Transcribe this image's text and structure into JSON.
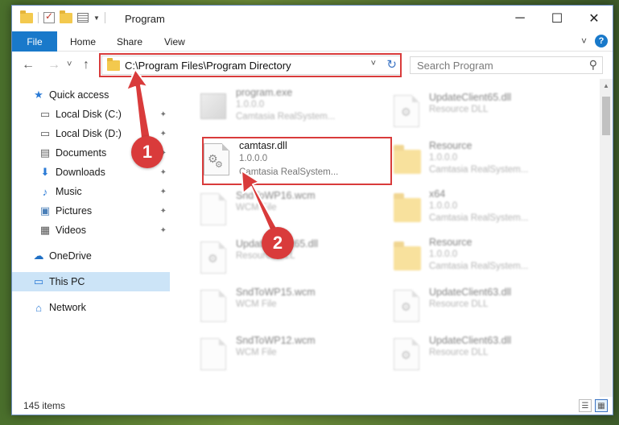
{
  "window": {
    "title": "Program",
    "controls": {
      "minimize": "─",
      "maximize": "☐",
      "close": "✕"
    }
  },
  "ribbon": {
    "file": "File",
    "tabs": [
      "Home",
      "Share",
      "View"
    ],
    "collapse": "˅",
    "help": "?"
  },
  "nav": {
    "back": "←",
    "forward": "→",
    "recent": "˅",
    "up": "↑",
    "address": "C:\\Program Files\\Program Directory",
    "address_chevron": "˅",
    "refresh": "↻",
    "search_placeholder": "Search Program",
    "search_icon": "⚲"
  },
  "sidebar": {
    "items": [
      {
        "label": "Quick access",
        "icon": "star-icon",
        "glyph": "★",
        "pinned": false
      },
      {
        "label": "Local Disk (C:)",
        "icon": "drive-icon",
        "glyph": "▭",
        "pinned": true
      },
      {
        "label": "Local Disk (D:)",
        "icon": "drive-icon",
        "glyph": "▭",
        "pinned": true
      },
      {
        "label": "Documents",
        "icon": "documents-icon",
        "glyph": "▤",
        "pinned": true
      },
      {
        "label": "Downloads",
        "icon": "downloads-icon",
        "glyph": "⬇",
        "pinned": true
      },
      {
        "label": "Music",
        "icon": "music-icon",
        "glyph": "♪",
        "pinned": true
      },
      {
        "label": "Pictures",
        "icon": "pictures-icon",
        "glyph": "▣",
        "pinned": true
      },
      {
        "label": "Videos",
        "icon": "videos-icon",
        "glyph": "▦",
        "pinned": true
      },
      {
        "label": "OneDrive",
        "icon": "cloud-icon",
        "glyph": "☁",
        "pinned": false
      },
      {
        "label": "This PC",
        "icon": "computer-icon",
        "glyph": "▭",
        "pinned": false,
        "selected": true
      },
      {
        "label": "Network",
        "icon": "network-icon",
        "glyph": "⌂",
        "pinned": false
      }
    ],
    "pin_glyph": "📌"
  },
  "files": {
    "left": [
      {
        "name": "program.exe",
        "line2": "1.0.0.0",
        "line3": "Camtasia RealSystem...",
        "kind": "exe",
        "blurred": true
      },
      {
        "name": "camtasr.dll",
        "line2": "1.0.0.0",
        "line3": "Camtasia RealSystem...",
        "kind": "dll",
        "blurred": false
      },
      {
        "name": "SndToWP16.wcm",
        "line2": "WCM File",
        "line3": "",
        "kind": "doc",
        "blurred": true
      },
      {
        "name": "UpdateClient65.dll",
        "line2": "Resource DLL",
        "line3": "",
        "kind": "dll",
        "blurred": true
      },
      {
        "name": "SndToWP15.wcm",
        "line2": "WCM File",
        "line3": "",
        "kind": "doc",
        "blurred": true
      },
      {
        "name": "SndToWP12.wcm",
        "line2": "WCM File",
        "line3": "",
        "kind": "doc",
        "blurred": true
      }
    ],
    "right": [
      {
        "name": "UpdateClient65.dll",
        "line2": "Resource DLL",
        "line3": "",
        "kind": "dll",
        "blurred": true
      },
      {
        "name": "Resource",
        "line2": "1.0.0.0",
        "line3": "Camtasia RealSystem...",
        "kind": "folder",
        "blurred": true
      },
      {
        "name": "x64",
        "line2": "1.0.0.0",
        "line3": "Camtasia RealSystem...",
        "kind": "folder",
        "blurred": true
      },
      {
        "name": "Resource",
        "line2": "1.0.0.0",
        "line3": "Camtasia RealSystem...",
        "kind": "folder",
        "blurred": true
      },
      {
        "name": "UpdateClient63.dll",
        "line2": "Resource DLL",
        "line3": "",
        "kind": "dll",
        "blurred": true
      },
      {
        "name": "UpdateClient63.dll",
        "line2": "Resource DLL",
        "line3": "",
        "kind": "dll",
        "blurred": true
      }
    ]
  },
  "status": {
    "count": "145 items",
    "view_details": "☰",
    "view_tiles": "▦"
  },
  "annotations": {
    "step1": "1",
    "step2": "2",
    "color": "#d93b3b"
  }
}
